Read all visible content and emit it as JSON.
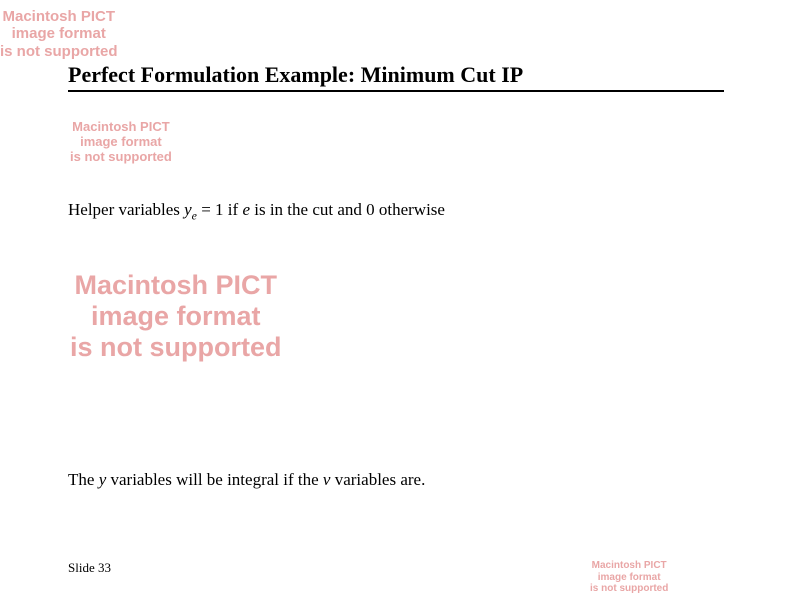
{
  "placeholders": {
    "line1": "Macintosh PICT",
    "line2": "image format",
    "line3": "is not supported"
  },
  "title": "Perfect Formulation Example: Minimum Cut IP",
  "helper": {
    "prefix": "Helper variables ",
    "var": "y",
    "sub": "e",
    "mid1": " = 1 if ",
    "e": "e",
    "mid2": " is in the cut and 0 otherwise"
  },
  "integral": {
    "prefix": "The ",
    "y": "y",
    "mid1": " variables will be integral if the ",
    "v": "v",
    "suffix": " variables are."
  },
  "slide_label": "Slide 33"
}
